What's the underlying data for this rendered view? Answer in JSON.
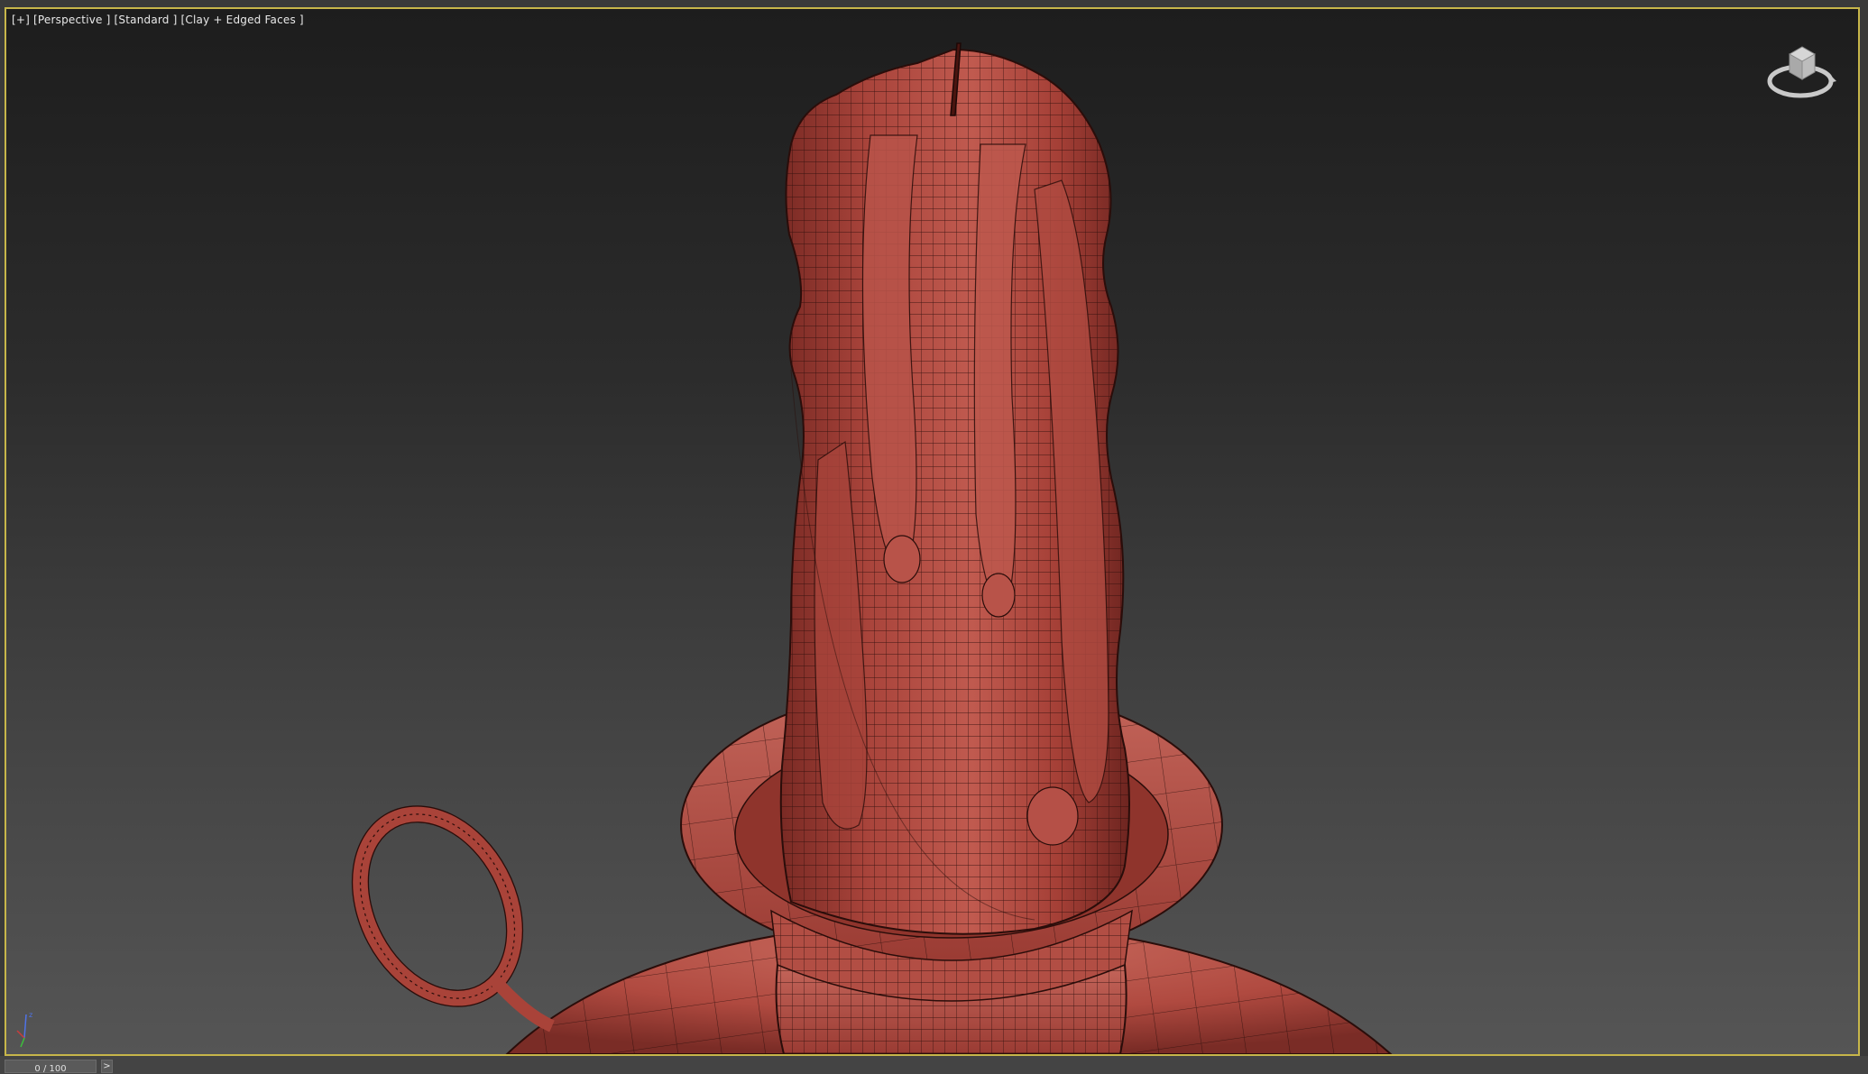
{
  "viewport": {
    "menu_plus": "[+]",
    "view_mode": "[Perspective ]",
    "preset": "[Standard ]",
    "shading": "[Clay + Edged Faces ]"
  },
  "viewcube": {
    "icon": "viewcube-icon"
  },
  "axis_tripod": {
    "icon": "axis-tripod-icon",
    "x_color": "#c83c3c",
    "y_color": "#3cbf3c",
    "z_color": "#4f73e8"
  },
  "model": {
    "description_icon": "candle-mesh",
    "clay_color": "#b54a40",
    "wire_color": "#2a0d0a"
  },
  "timeline": {
    "frame_display": "0 / 100",
    "next_button": ">"
  },
  "colors": {
    "viewport_border": "#c7b64a",
    "label_text": "#e9e9e9"
  }
}
